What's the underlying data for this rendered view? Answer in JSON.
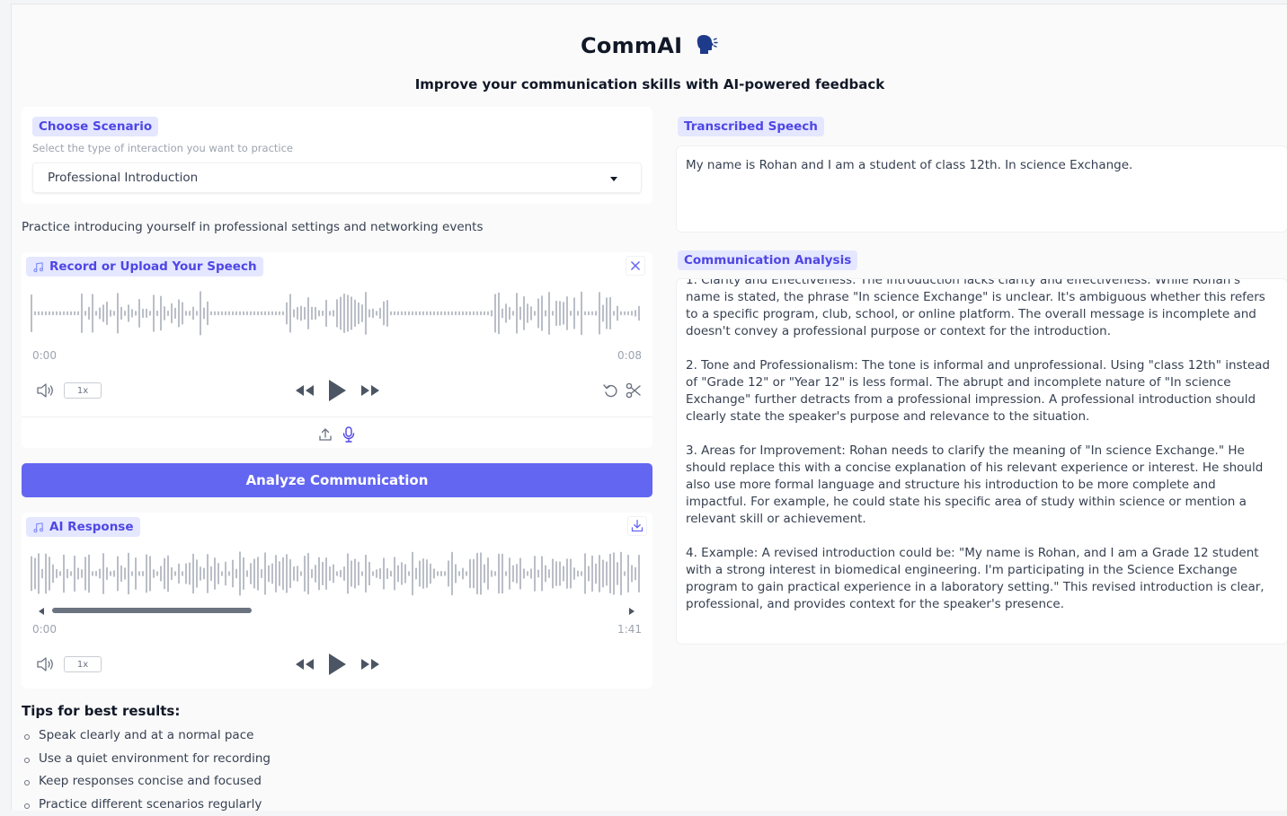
{
  "app": {
    "title": "CommAI",
    "title_icon": "speaking-head-icon",
    "subtitle": "Improve your communication skills with AI-powered feedback"
  },
  "scenario": {
    "label": "Choose Scenario",
    "hint": "Select the type of interaction you want to practice",
    "selected": "Professional Introduction",
    "description": "Practice introducing yourself in professional settings and networking events"
  },
  "record": {
    "label": "Record or Upload Your Speech",
    "time_current": "0:00",
    "time_total": "0:08",
    "speed": "1x",
    "icons": [
      "close-icon",
      "volume-icon",
      "rewind-icon",
      "play-icon",
      "fast-forward-icon",
      "undo-icon",
      "scissors-icon",
      "upload-icon",
      "microphone-icon"
    ]
  },
  "analyze_button": "Analyze Communication",
  "ai_response": {
    "label": "AI Response",
    "time_current": "0:00",
    "time_total": "1:41",
    "speed": "1x",
    "scroll_position": 0.0,
    "icons": [
      "download-icon",
      "volume-icon",
      "rewind-icon",
      "play-icon",
      "fast-forward-icon"
    ]
  },
  "tips": {
    "title": "Tips for best results:",
    "items": [
      "Speak clearly and at a normal pace",
      "Use a quiet environment for recording",
      "Keep responses concise and focused",
      "Practice different scenarios regularly"
    ]
  },
  "transcription": {
    "label": "Transcribed Speech",
    "text": "My name is Rohan and I am a student of class 12th.  In science Exchange."
  },
  "analysis": {
    "label": "Communication Analysis",
    "paragraphs": [
      "1. Clarity and Effectiveness: The introduction lacks clarity and effectiveness.  While Rohan's name is stated, the phrase \"In science Exchange\" is unclear.  It's ambiguous whether this refers to a specific program, club, school, or online platform.  The overall message is incomplete and doesn't convey a professional purpose or context for the introduction.",
      "2. Tone and Professionalism: The tone is informal and unprofessional.  Using \"class 12th\" instead of \"Grade 12\" or \"Year 12\" is less formal.  The abrupt and incomplete nature of \"In science Exchange\" further detracts from a professional impression.  A professional introduction should clearly state the speaker's purpose and relevance to the situation.",
      "3. Areas for Improvement:  Rohan needs to clarify the meaning of \"In science Exchange.\" He should replace this with a concise explanation of his relevant experience or interest.  He should also use more formal language and structure his introduction to be more complete and impactful.  For example, he could state his specific area of study within science or mention a relevant skill or achievement.",
      "4. Example: A revised introduction could be: \"My name is Rohan, and I am a Grade 12 student with a strong interest in biomedical engineering. I'm participating in the Science Exchange program to gain practical experience in a laboratory setting.\"  This revised introduction is clear, professional, and provides context for the speaker's presence."
    ]
  },
  "colors": {
    "accent": "#6366f1",
    "tag_background": "#e4e7ff",
    "tag_text": "#4f46e5",
    "waveform": "#9ca3af"
  }
}
